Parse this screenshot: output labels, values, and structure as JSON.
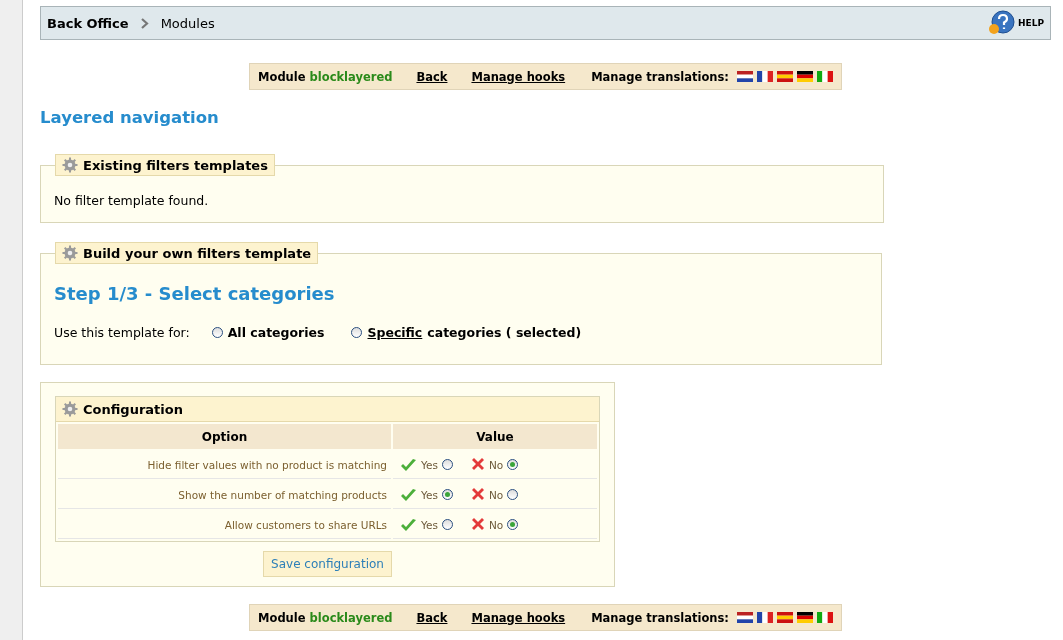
{
  "breadcrumb": {
    "items": [
      "Back Office",
      "Modules"
    ],
    "help": "HELP"
  },
  "module_bar_top": {
    "label": "Module",
    "module": "blocklayered",
    "links": [
      "Back",
      "Manage hooks"
    ],
    "translations": "Manage translations:"
  },
  "page_title": "Layered navigation",
  "existing_templates": {
    "legend": "Existing filters templates",
    "message": "No filter template found."
  },
  "build_template": {
    "legend": "Build your own filters template",
    "step": "Step 1/3 - Select categories",
    "prompt": "Use this template for:",
    "options": [
      {
        "label": "All categories",
        "selected": false
      },
      {
        "link": "Specific",
        "label": "categories ( selected)",
        "selected": false
      }
    ]
  },
  "configuration": {
    "legend": "Configuration",
    "columns": [
      "Option",
      "Value"
    ],
    "rows": [
      {
        "option": "Hide filter values with no product is matching",
        "yes": "Yes",
        "no": "No",
        "yes_selected": false,
        "no_selected": true
      },
      {
        "option": "Show the number of matching products",
        "yes": "Yes",
        "no": "No",
        "yes_selected": true,
        "no_selected": false
      },
      {
        "option": "Allow customers to share URLs",
        "yes": "Yes",
        "no": "No",
        "yes_selected": false,
        "no_selected": true
      }
    ],
    "save": "Save configuration"
  },
  "module_bar_bottom": {
    "label": "Module",
    "module": "blocklayered",
    "links": [
      "Back",
      "Manage hooks"
    ],
    "translations": "Manage translations:"
  }
}
